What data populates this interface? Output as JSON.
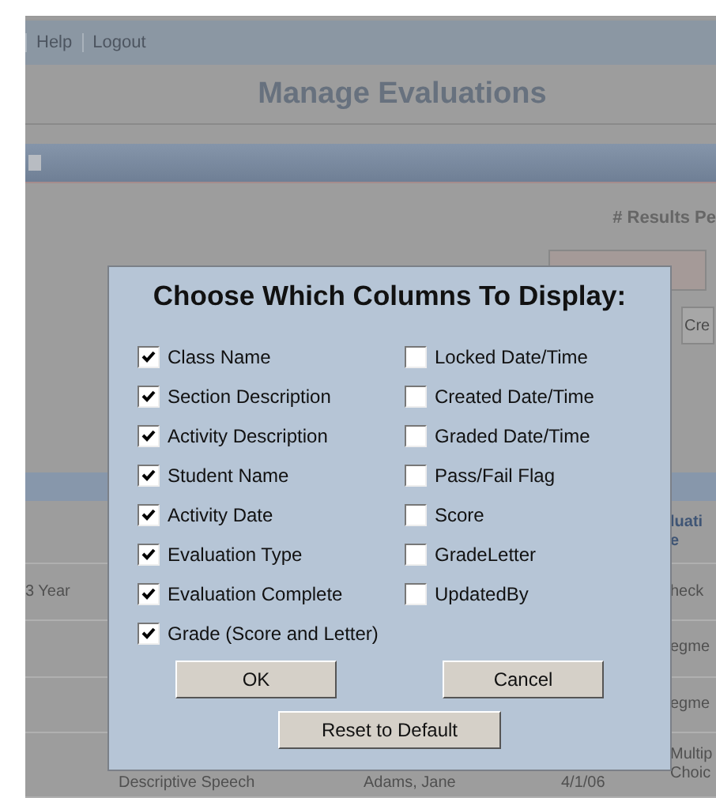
{
  "nav": {
    "links": [
      "Help",
      "Logout"
    ]
  },
  "page_title": "Manage Evaluations",
  "results_label": "# Results Pe",
  "side_button": "Cre",
  "table": {
    "header": [
      "luati",
      "e"
    ],
    "rows": [
      {
        "left": "3 Year",
        "right": [
          "heck"
        ]
      },
      {
        "left": "",
        "right": [
          "egme"
        ]
      },
      {
        "left": "",
        "right": [
          "egme"
        ]
      }
    ],
    "last_row": {
      "cells": [
        "Descriptive Speech",
        "Adams, Jane",
        "4/1/06"
      ],
      "right": [
        "Multip",
        "Choic"
      ]
    }
  },
  "dialog": {
    "title": "Choose Which Columns To Display:",
    "left_options": [
      {
        "label": "Class Name",
        "checked": true
      },
      {
        "label": "Section Description",
        "checked": true
      },
      {
        "label": "Activity Description",
        "checked": true
      },
      {
        "label": "Student Name",
        "checked": true
      },
      {
        "label": "Activity Date",
        "checked": true
      },
      {
        "label": "Evaluation Type",
        "checked": true
      },
      {
        "label": "Evaluation Complete",
        "checked": true
      },
      {
        "label": "Grade (Score and Letter)",
        "checked": true
      }
    ],
    "right_options": [
      {
        "label": "Locked Date/Time",
        "checked": false
      },
      {
        "label": "Created Date/Time",
        "checked": false
      },
      {
        "label": "Graded Date/Time",
        "checked": false
      },
      {
        "label": "Pass/Fail Flag",
        "checked": false
      },
      {
        "label": "Score",
        "checked": false
      },
      {
        "label": "GradeLetter",
        "checked": false
      },
      {
        "label": "UpdatedBy",
        "checked": false
      }
    ],
    "ok": "OK",
    "cancel": "Cancel",
    "reset": "Reset to Default"
  }
}
